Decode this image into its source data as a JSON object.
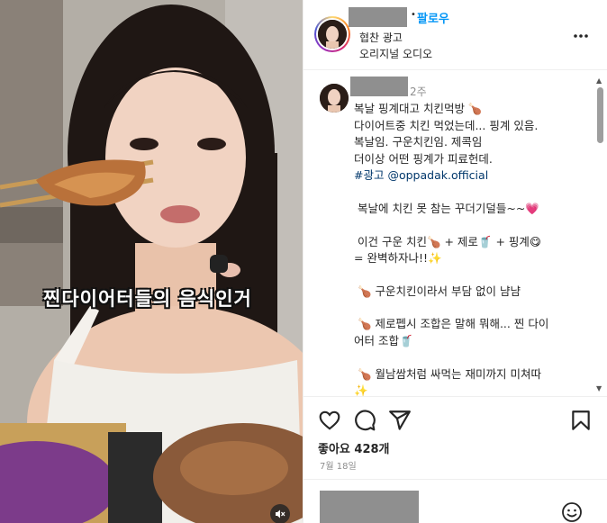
{
  "media": {
    "overlay_caption": "찐다이어터들의 음식인거",
    "mute_icon": "speaker-muted-icon"
  },
  "header": {
    "dot": "•",
    "follow_label": "팔로우",
    "subtitle_1": "협찬 광고",
    "subtitle_2": "오리지널 오디오",
    "more_icon": "more-dots-icon"
  },
  "comment": {
    "time": "2주",
    "lines": [
      "복날 핑계대고 치킨먹방 🍗",
      "다이어트중 치킨 먹었는데... 핑계 있음.",
      "복날임. 구운치킨임. 제콕임",
      "더이상 어떤 핑계가 피료헌데.",
      "",
      "복날에 치킨 못 참는 꾸더기덜들~~💗",
      "이건 구운 치킨🍗 + 제로🥤 + 핑계😋",
      "= 완벽하자나!!✨",
      "🍗 구운치킨이라서 부담 없이 냠냠",
      "🍗 제로펩시 조합은 말해 뭐해... 찐 다이",
      "어터 조합🥤",
      "🍗 월남쌈처럼 싸먹는 재미까지 미쳐따",
      "✨"
    ],
    "hashtag_ad": "#광고",
    "mention": "@oppadak.official"
  },
  "actions": {
    "like_icon": "heart-icon",
    "comment_icon": "comment-icon",
    "share_icon": "send-icon",
    "save_icon": "bookmark-icon"
  },
  "likes_text": "좋아요 428개",
  "date_text": "7월 18일",
  "add_comment": {
    "emoji_icon": "smiley-icon"
  },
  "colors": {
    "follow_blue": "#0095f6",
    "hashtag_blue": "#00376b",
    "redaction_gray": "#8f8f8f"
  }
}
